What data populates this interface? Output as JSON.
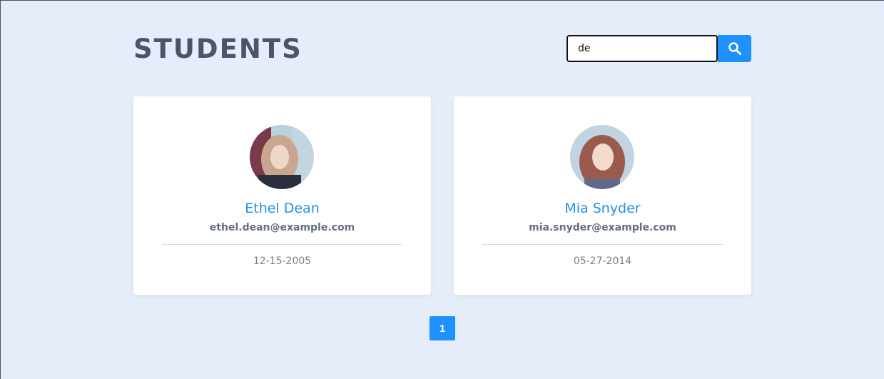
{
  "header": {
    "title": "STUDENTS"
  },
  "search": {
    "value": "de",
    "button_icon": "search-icon"
  },
  "students": [
    {
      "name": "Ethel Dean",
      "email": "ethel.dean@example.com",
      "date": "12-15-2005"
    },
    {
      "name": "Mia Snyder",
      "email": "mia.snyder@example.com",
      "date": "05-27-2014"
    }
  ],
  "pagination": {
    "pages": [
      "1"
    ],
    "current": "1"
  },
  "colors": {
    "background": "#e4edf9",
    "accent": "#1e90ff",
    "title": "#4a5567"
  }
}
